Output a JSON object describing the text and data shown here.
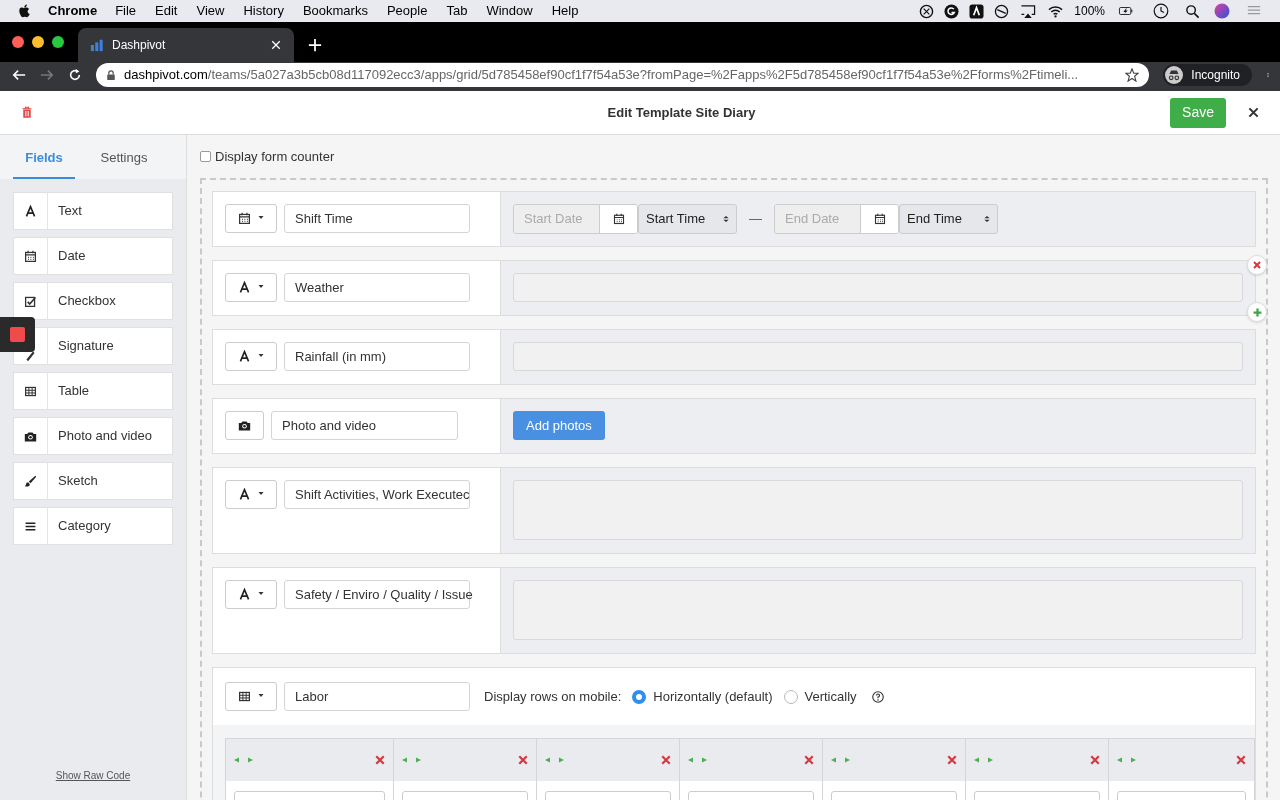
{
  "menubar": {
    "app": "Chrome",
    "items": [
      "File",
      "Edit",
      "View",
      "History",
      "Bookmarks",
      "People",
      "Tab",
      "Window",
      "Help"
    ],
    "battery": "100%"
  },
  "browser": {
    "tab": "Dashpivot",
    "url_host": "dashpivot.com",
    "url_path": "/teams/5a027a3b5cb08d117092ecc3/apps/grid/5d785458ef90cf1f7f54a53e?fromPage=%2Fapps%2F5d785458ef90cf1f7f54a53e%2Fforms%2Ftimeli...",
    "profile": "Incognito"
  },
  "header": {
    "title": "Edit Template Site Diary",
    "save": "Save"
  },
  "sidebar": {
    "tabs": [
      {
        "label": "Fields",
        "selected": true
      },
      {
        "label": "Settings",
        "selected": false
      }
    ],
    "items": [
      {
        "label": "Text",
        "kind": "text"
      },
      {
        "label": "Date",
        "kind": "date"
      },
      {
        "label": "Checkbox",
        "kind": "checkbox"
      },
      {
        "label": "Signature",
        "kind": "signature"
      },
      {
        "label": "Table",
        "kind": "table"
      },
      {
        "label": "Photo and video",
        "kind": "photo"
      },
      {
        "label": "Sketch",
        "kind": "sketch"
      },
      {
        "label": "Category",
        "kind": "category"
      }
    ],
    "footer_link": "Show Raw Code"
  },
  "form": {
    "counter": {
      "label": "Display form counter",
      "checked": false
    },
    "fields": [
      {
        "kind": "datetime",
        "label": "Shift Time",
        "start_date": "Start Date",
        "start_time": "Start Time",
        "separator": "—",
        "end_date": "End Date",
        "end_time": "End Time",
        "hovered": false
      },
      {
        "kind": "text",
        "label": "Weather",
        "hovered": true
      },
      {
        "kind": "text",
        "label": "Rainfall (in mm)",
        "hovered": false
      },
      {
        "kind": "photo",
        "label": "Photo and video",
        "button": "Add photos",
        "hovered": false
      },
      {
        "kind": "textarea",
        "label": "Shift Activities, Work Executec",
        "hovered": false
      },
      {
        "kind": "textarea",
        "label": "Safety / Enviro / Quality / Issue",
        "hovered": false
      },
      {
        "kind": "table",
        "label": "Labor",
        "hovered": false,
        "mobile_label": "Display rows on mobile:",
        "options": [
          {
            "label": "Horizontally (default)",
            "selected": true
          },
          {
            "label": "Vertically",
            "selected": false
          }
        ],
        "columns": [
          {
            "kind": "column"
          },
          {
            "kind": "column"
          },
          {
            "kind": "column"
          },
          {
            "kind": "column"
          },
          {
            "kind": "column"
          },
          {
            "kind": "column"
          },
          {
            "kind": "column"
          }
        ]
      }
    ]
  }
}
